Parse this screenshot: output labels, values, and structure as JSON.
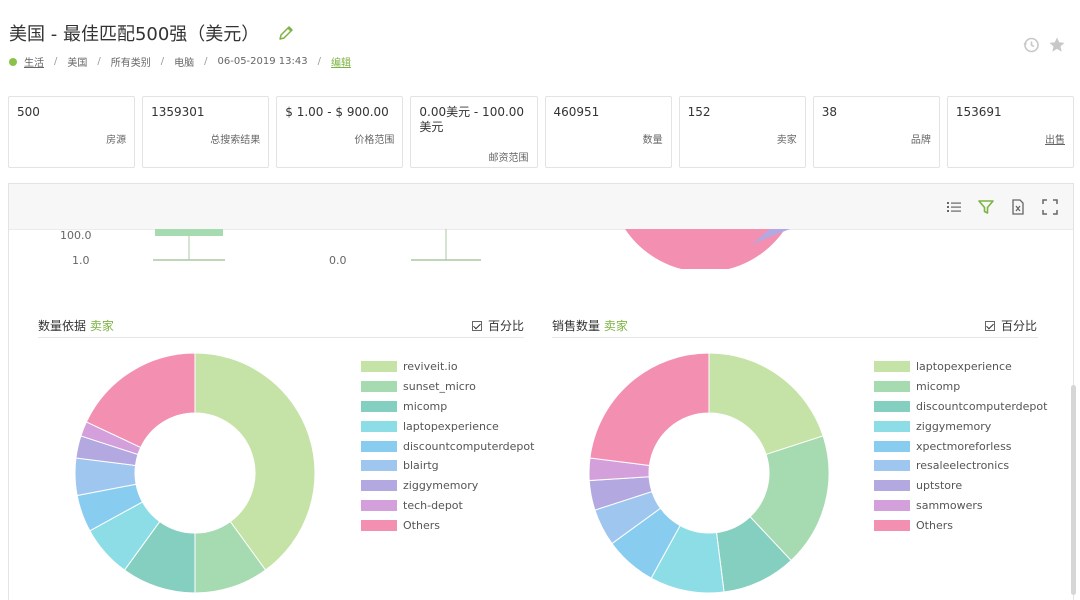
{
  "header": {
    "title": "美国 - 最佳匹配500强（美元）"
  },
  "breadcrumb": {
    "items": [
      "生活",
      "美国",
      "所有类别",
      "电脑",
      "06-05-2019 13:43",
      "编辑"
    ],
    "sep": "/"
  },
  "stats": [
    {
      "value": "500",
      "label": "房源"
    },
    {
      "value": "1359301",
      "label": "总搜索结果"
    },
    {
      "value": "$ 1.00 - $ 900.00",
      "label": "价格范围"
    },
    {
      "value": "0.00美元 - 100.00美元",
      "label": "邮资范围"
    },
    {
      "value": "460951",
      "label": "数量"
    },
    {
      "value": "152",
      "label": "卖家"
    },
    {
      "value": "38",
      "label": "品牌"
    },
    {
      "value": "153691",
      "label": "出售"
    }
  ],
  "upper_partial": {
    "axis_left": [
      "100.0",
      "1.0"
    ],
    "axis_mid": [
      "0.0"
    ]
  },
  "left_section": {
    "title_prefix": "数量依据",
    "title_accent": "卖家",
    "percent_label": "百分比"
  },
  "right_section": {
    "title_prefix": "销售数量",
    "title_accent": "卖家",
    "percent_label": "百分比"
  },
  "colors": {
    "accent": "#7cb342",
    "palette": [
      "#c5e3a6",
      "#a6dab0",
      "#85cfc0",
      "#8ddde6",
      "#88cdf0",
      "#9ec6ef",
      "#b3a9e0",
      "#d3a0dc",
      "#f390b1"
    ]
  },
  "chart_data": [
    {
      "type": "pie",
      "title": "数量依据 卖家",
      "categories": [
        "reviveit.io",
        "sunset_micro",
        "micomp",
        "laptopexperience",
        "discountcomputerdepot",
        "blairtg",
        "ziggymemory",
        "tech-depot",
        "Others"
      ],
      "values": [
        40,
        10,
        10,
        7,
        5,
        5,
        3,
        2,
        18
      ]
    },
    {
      "type": "pie",
      "title": "销售数量 卖家",
      "categories": [
        "laptopexperience",
        "micomp",
        "discountcomputerdepot",
        "ziggymemory",
        "xpectmoreforless",
        "resaleelectronics",
        "uptstore",
        "sammowers",
        "Others"
      ],
      "values": [
        20,
        18,
        10,
        10,
        7,
        5,
        4,
        3,
        23
      ]
    }
  ]
}
